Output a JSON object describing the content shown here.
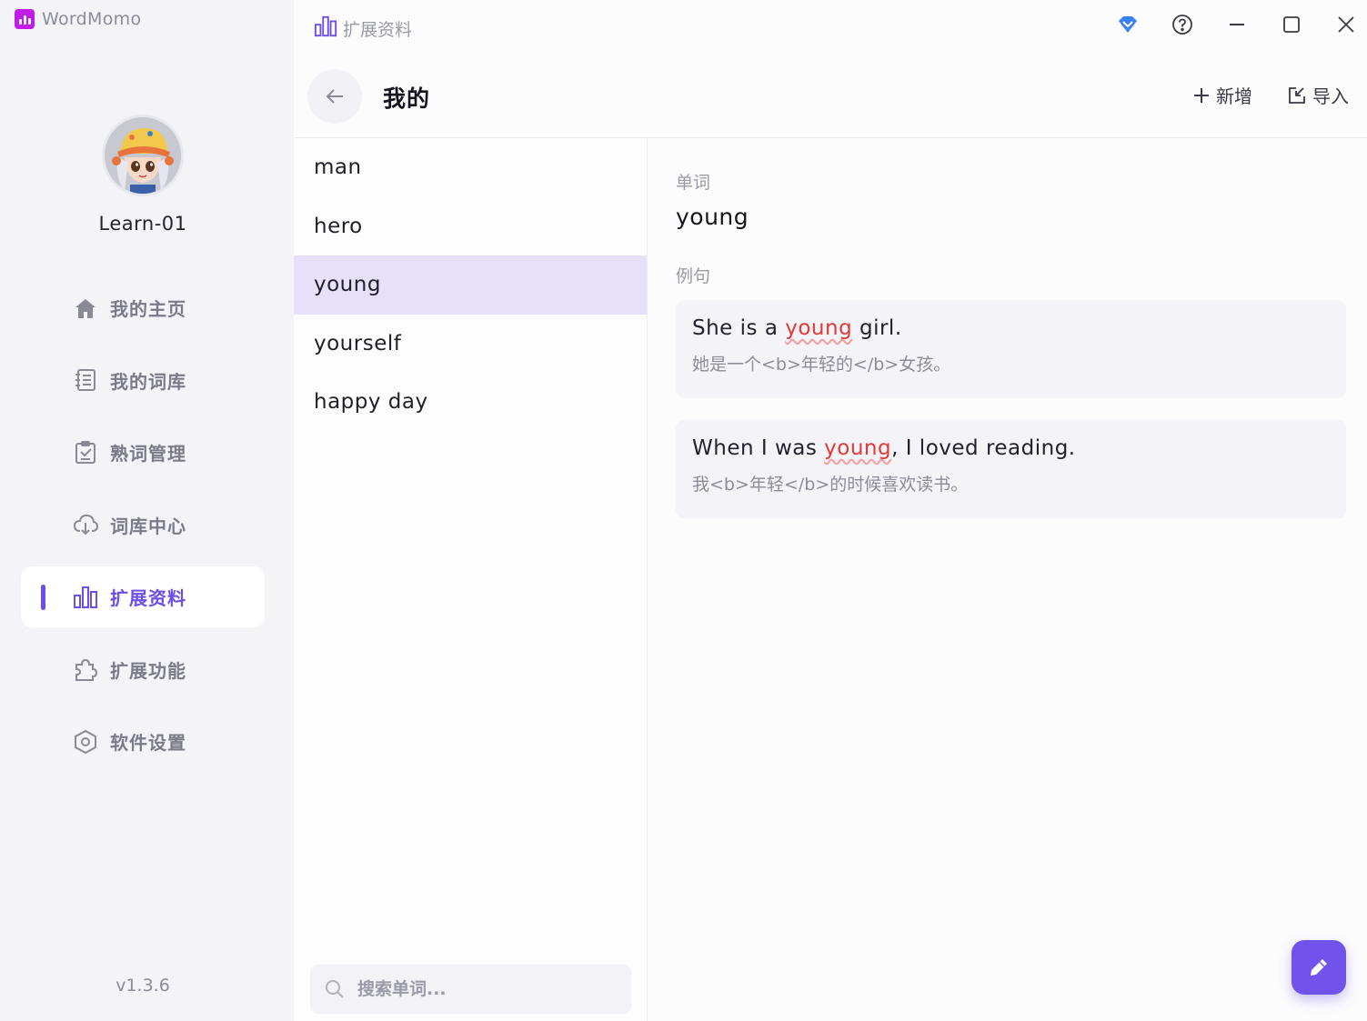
{
  "app": {
    "name": "WordMomo",
    "version": "v1.3.6"
  },
  "user": {
    "name": "Learn-01"
  },
  "nav": [
    {
      "key": "home",
      "label": "我的主页",
      "icon": "home-icon"
    },
    {
      "key": "library",
      "label": "我的词库",
      "icon": "notebook-icon"
    },
    {
      "key": "familiar",
      "label": "熟词管理",
      "icon": "clipboard-check-icon"
    },
    {
      "key": "center",
      "label": "词库中心",
      "icon": "cloud-download-icon"
    },
    {
      "key": "extended",
      "label": "扩展资料",
      "icon": "bar-chart-icon",
      "active": true
    },
    {
      "key": "plugins",
      "label": "扩展功能",
      "icon": "puzzle-icon"
    },
    {
      "key": "settings",
      "label": "软件设置",
      "icon": "settings-hexagon-icon"
    }
  ],
  "topbar": {
    "breadcrumb": "扩展资料"
  },
  "header": {
    "title": "我的",
    "add_label": "新增",
    "import_label": "导入"
  },
  "words": [
    "man",
    "hero",
    "young",
    "yourself",
    "happy day"
  ],
  "selected_word_index": 2,
  "search": {
    "placeholder": "搜索单词..."
  },
  "detail": {
    "word_label": "单词",
    "word": "young",
    "examples_label": "例句",
    "examples": [
      {
        "before": "She is a ",
        "highlight": "young",
        "after": " girl.",
        "zh": "她是一个<b>年轻的</b>女孩。"
      },
      {
        "before": "When I was ",
        "highlight": "young",
        "after": ", I loved reading.",
        "zh": "我<b>年轻</b>的时候喜欢读书。"
      }
    ]
  },
  "colors": {
    "accent": "#6d4ee8",
    "logo": "#c21de8",
    "highlight": "#e53935",
    "selected_row": "#e6e0fa",
    "vip": "#3b82f6"
  }
}
